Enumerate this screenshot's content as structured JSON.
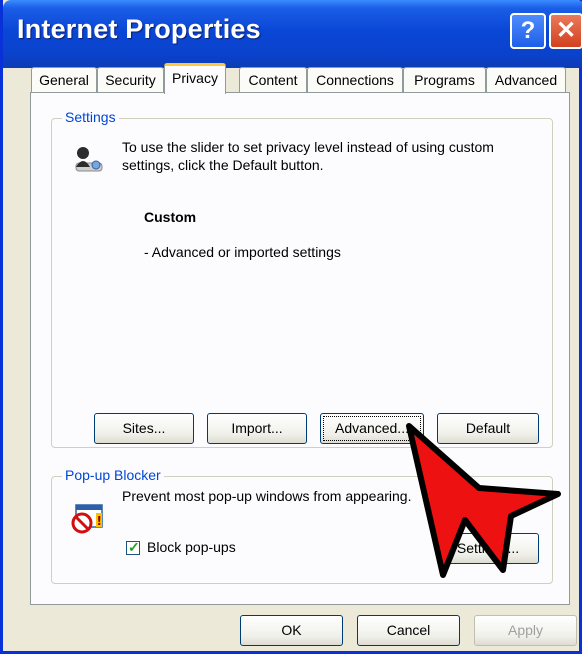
{
  "window": {
    "title": "Internet Properties",
    "help_glyph": "?",
    "close_glyph": "✕"
  },
  "tabs": [
    {
      "label": "General"
    },
    {
      "label": "Security"
    },
    {
      "label": "Privacy",
      "active": true
    },
    {
      "label": "Content"
    },
    {
      "label": "Connections"
    },
    {
      "label": "Programs"
    },
    {
      "label": "Advanced"
    }
  ],
  "settings": {
    "group_label": "Settings",
    "info_line1": "To use the slider to set privacy level instead of using custom",
    "info_line2": "settings, click the Default button.",
    "level_title": "Custom",
    "level_desc": "- Advanced or imported settings",
    "buttons": {
      "sites": "Sites...",
      "import": "Import...",
      "advanced": "Advanced...",
      "default": "Default"
    }
  },
  "popup": {
    "group_label": "Pop-up Blocker",
    "desc": "Prevent most pop-up windows from appearing.",
    "checkbox_label": "Block pop-ups",
    "checked": true,
    "settings_button": "Settings..."
  },
  "footer": {
    "ok": "OK",
    "cancel": "Cancel",
    "apply": "Apply"
  },
  "icons": {
    "privacy": "privacy-person-icon",
    "popup": "popup-blocker-icon",
    "pointer": "red-arrow-pointer-icon"
  }
}
